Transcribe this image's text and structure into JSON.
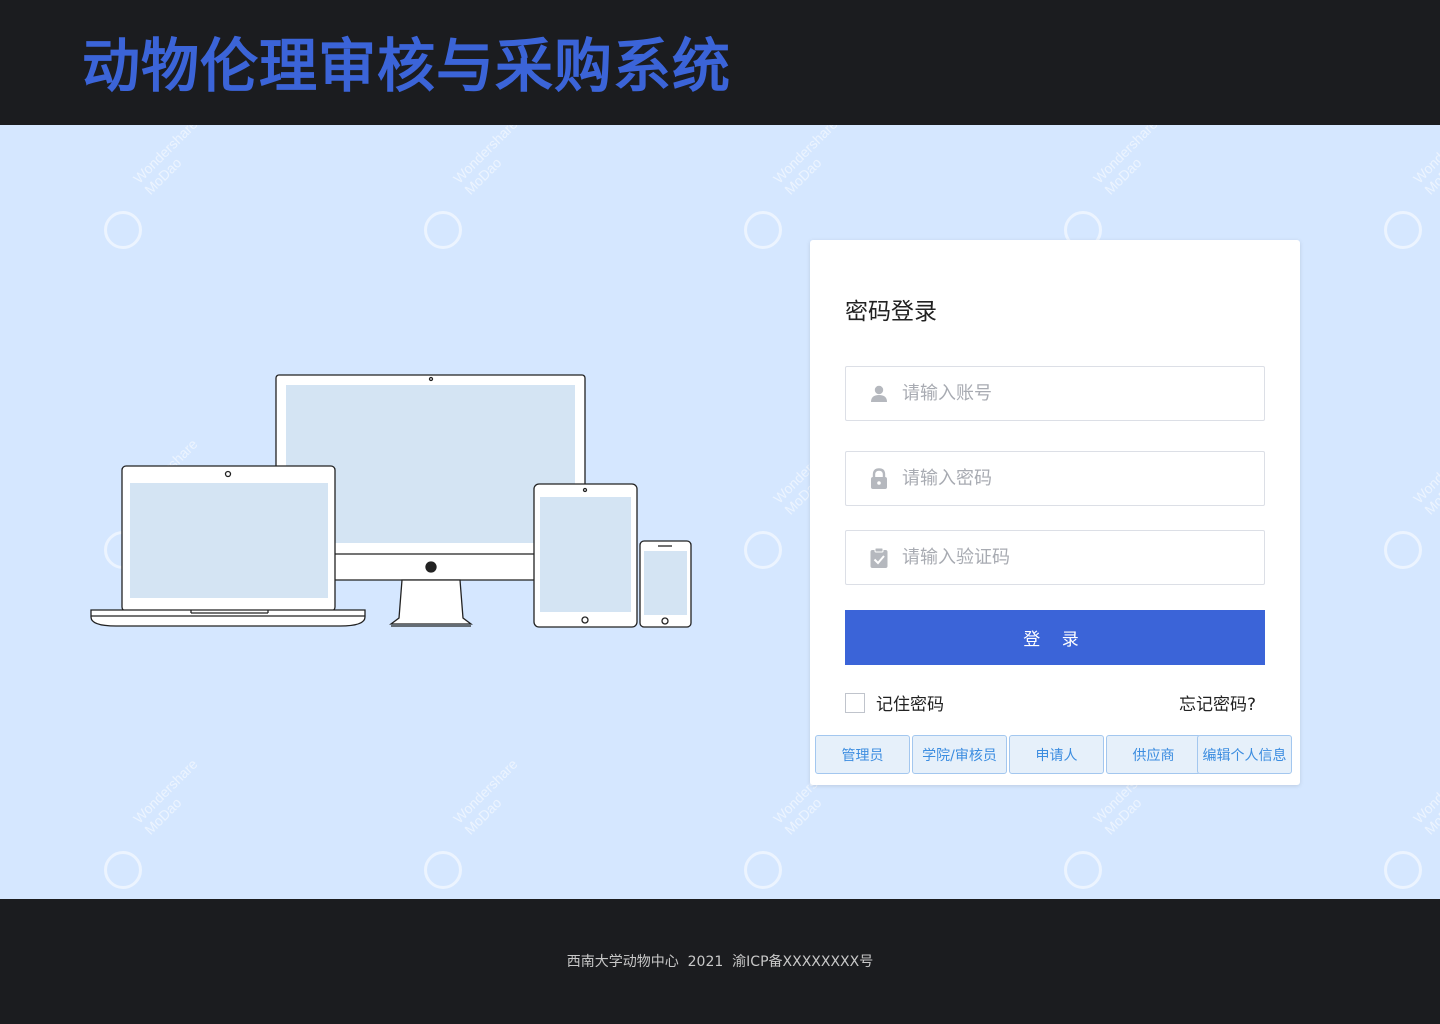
{
  "header": {
    "title": "动物伦理审核与采购系统"
  },
  "watermark": {
    "line1": "Wondershare",
    "line2": "MoDao"
  },
  "login": {
    "title": "密码登录",
    "account_placeholder": "请输入账号",
    "password_placeholder": "请输入密码",
    "captcha_placeholder": "请输入验证码",
    "submit_label": "登 录",
    "remember_label": "记住密码",
    "forgot_label": "忘记密码?"
  },
  "roles": [
    {
      "label": "管理员"
    },
    {
      "label": "学院/审核员"
    },
    {
      "label": "申请人"
    },
    {
      "label": "供应商"
    },
    {
      "label": "编辑个人信息"
    }
  ],
  "footer": {
    "text": "西南大学动物中心  2021  渝ICP备XXXXXXXX号"
  },
  "colors": {
    "accent": "#3b64d8",
    "background": "#d5e7ff",
    "dark": "#1b1c1f",
    "role_text": "#3c8de0"
  },
  "icons": {
    "account": "user-icon",
    "password": "lock-icon",
    "captcha": "clipboard-check-icon"
  }
}
